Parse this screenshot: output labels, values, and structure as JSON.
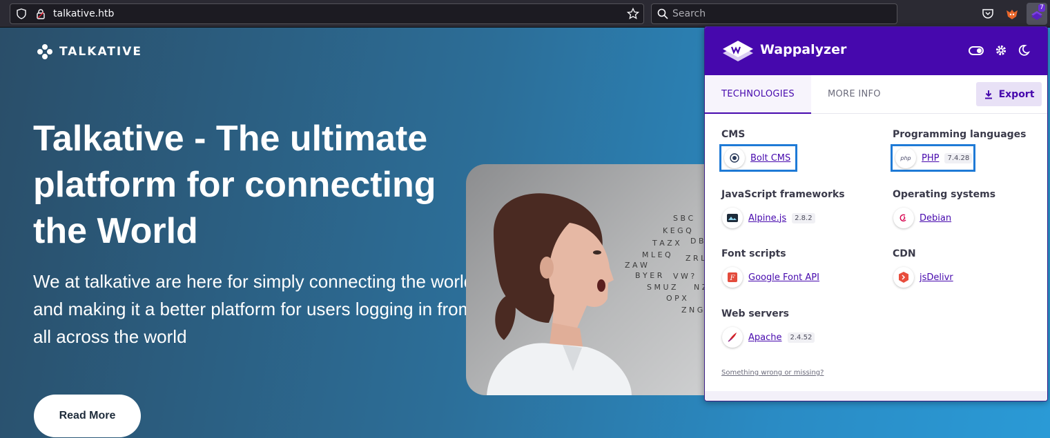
{
  "browser": {
    "url": "talkative.htb",
    "search_placeholder": "Search",
    "extension_badge": "7"
  },
  "site": {
    "brand": "TALKATIVE",
    "hero_title": "Talkative - The ultimate platform for connecting the World",
    "hero_subtitle": "We at talkative are here for simply connecting the world and making it a better platform for users logging in from all across the world",
    "read_more_label": "Read More"
  },
  "wappalyzer": {
    "title": "Wappalyzer",
    "tabs": [
      "TECHNOLOGIES",
      "MORE INFO"
    ],
    "export_label": "Export",
    "categories": [
      {
        "name": "CMS",
        "techs": [
          {
            "name": "Bolt CMS",
            "version": ""
          }
        ]
      },
      {
        "name": "Programming languages",
        "techs": [
          {
            "name": "PHP",
            "version": "7.4.28"
          }
        ]
      },
      {
        "name": "JavaScript frameworks",
        "techs": [
          {
            "name": "Alpine.js",
            "version": "2.8.2"
          }
        ]
      },
      {
        "name": "Operating systems",
        "techs": [
          {
            "name": "Debian",
            "version": ""
          }
        ]
      },
      {
        "name": "Font scripts",
        "techs": [
          {
            "name": "Google Font API",
            "version": ""
          }
        ]
      },
      {
        "name": "CDN",
        "techs": [
          {
            "name": "jsDelivr",
            "version": ""
          }
        ]
      },
      {
        "name": "Web servers",
        "techs": [
          {
            "name": "Apache",
            "version": "2.4.52"
          }
        ]
      }
    ],
    "footer_link": "Something wrong or missing?",
    "colors": {
      "header": "#4608ad",
      "highlight": "#1e7ad6"
    }
  }
}
